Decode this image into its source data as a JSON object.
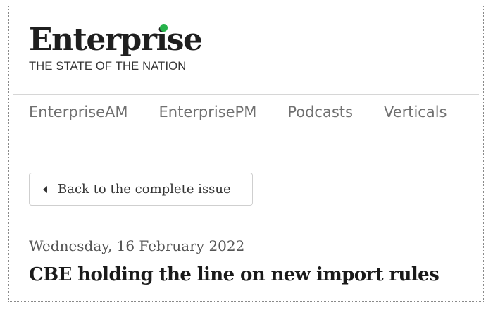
{
  "brand": {
    "logo_text": "Enterprise",
    "tagline": "THE STATE OF THE NATION",
    "accent_color": "#27b34b"
  },
  "nav": {
    "items": [
      "EnterpriseAM",
      "EnterprisePM",
      "Podcasts",
      "Verticals"
    ]
  },
  "back_button": {
    "label": "Back to the complete issue",
    "icon": "caret-left-icon"
  },
  "article": {
    "date": "Wednesday, 16 February 2022",
    "headline": "CBE holding the line on new import rules"
  }
}
